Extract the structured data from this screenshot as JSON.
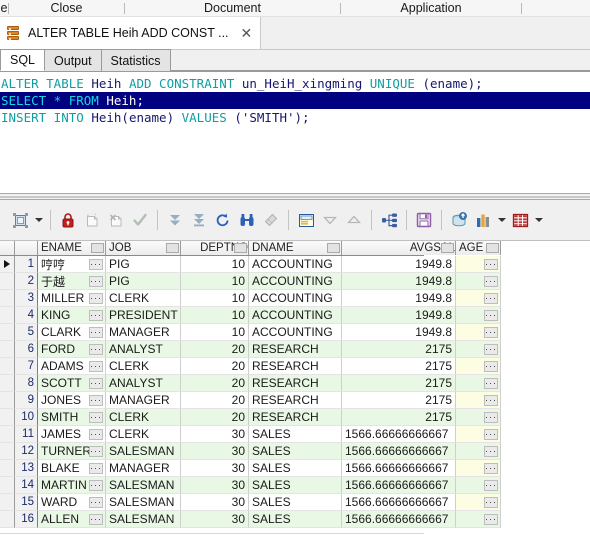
{
  "menubar": {
    "partial": "e",
    "items": [
      "Close",
      "Document",
      "Application"
    ]
  },
  "doc_tab": {
    "icon": "database-icon",
    "title": "ALTER TABLE Heih ADD CONST ...",
    "close_label": "✕"
  },
  "subtabs": [
    {
      "label": "SQL",
      "active": true
    },
    {
      "label": "Output",
      "active": false
    },
    {
      "label": "Statistics",
      "active": false
    }
  ],
  "editor": {
    "lines": [
      {
        "selected": false,
        "parts": [
          {
            "t": "ALTER TABLE ",
            "c": "kw"
          },
          {
            "t": "Heih ",
            "c": "id"
          },
          {
            "t": "ADD CONSTRAINT ",
            "c": "kw"
          },
          {
            "t": "un_HeiH_xingming ",
            "c": "id"
          },
          {
            "t": "UNIQUE ",
            "c": "kw"
          },
          {
            "t": "(ename);",
            "c": "id"
          }
        ]
      },
      {
        "selected": true,
        "parts": [
          {
            "t": "SELECT * FROM ",
            "c": "kw"
          },
          {
            "t": "Heih;",
            "c": "id"
          }
        ]
      },
      {
        "selected": false,
        "parts": [
          {
            "t": "INSERT INTO ",
            "c": "kw"
          },
          {
            "t": "Heih(ename) ",
            "c": "id"
          },
          {
            "t": "VALUES ",
            "c": "kw"
          },
          {
            "t": "('SMITH');",
            "c": "id"
          }
        ]
      }
    ]
  },
  "result_toolbar": {
    "buttons": [
      {
        "name": "single-record-view-icon",
        "kind": "record"
      },
      {
        "name": "dropdown-caret-icon",
        "kind": "caret"
      },
      {
        "name": "separator",
        "kind": "sep"
      },
      {
        "name": "lock-icon",
        "kind": "lock"
      },
      {
        "name": "insert-record-icon",
        "kind": "insert"
      },
      {
        "name": "delete-record-icon",
        "kind": "delete"
      },
      {
        "name": "post-changes-icon",
        "kind": "check"
      },
      {
        "name": "separator",
        "kind": "sep"
      },
      {
        "name": "fetch-next-page-icon",
        "kind": "dblarrow"
      },
      {
        "name": "fetch-all-rows-icon",
        "kind": "arrowbar"
      },
      {
        "name": "refresh-icon",
        "kind": "refresh"
      },
      {
        "name": "find-icon",
        "kind": "binoculars"
      },
      {
        "name": "clear-filter-icon",
        "kind": "eraser"
      },
      {
        "name": "separator",
        "kind": "sep"
      },
      {
        "name": "form-view-icon",
        "kind": "form"
      },
      {
        "name": "sort-descending-icon",
        "kind": "triangle-down"
      },
      {
        "name": "sort-ascending-icon",
        "kind": "triangle-up"
      },
      {
        "name": "separator",
        "kind": "sep"
      },
      {
        "name": "data-lineage-icon",
        "kind": "lineage"
      },
      {
        "name": "separator",
        "kind": "sep"
      },
      {
        "name": "save-icon",
        "kind": "save"
      },
      {
        "name": "separator",
        "kind": "sep"
      },
      {
        "name": "export-database-icon",
        "kind": "dbexport"
      },
      {
        "name": "chart-icon",
        "kind": "chart"
      },
      {
        "name": "dropdown-caret-icon",
        "kind": "caret"
      },
      {
        "name": "grid-export-icon",
        "kind": "gridexport"
      },
      {
        "name": "dropdown-caret-icon",
        "kind": "caret"
      }
    ]
  },
  "grid": {
    "columns": [
      "ENAME",
      "JOB",
      "DEPTNO",
      "DNAME",
      "AVGSAL",
      "AGE"
    ],
    "rows": [
      {
        "n": "1",
        "ename": "哼哼",
        "job": "PIG",
        "deptno": "10",
        "dname": "ACCOUNTING",
        "avgsal": "1949.8",
        "age": ""
      },
      {
        "n": "2",
        "ename": "于越",
        "job": "PIG",
        "deptno": "10",
        "dname": "ACCOUNTING",
        "avgsal": "1949.8",
        "age": ""
      },
      {
        "n": "3",
        "ename": "MILLER",
        "job": "CLERK",
        "deptno": "10",
        "dname": "ACCOUNTING",
        "avgsal": "1949.8",
        "age": ""
      },
      {
        "n": "4",
        "ename": "KING",
        "job": "PRESIDENT",
        "deptno": "10",
        "dname": "ACCOUNTING",
        "avgsal": "1949.8",
        "age": ""
      },
      {
        "n": "5",
        "ename": "CLARK",
        "job": "MANAGER",
        "deptno": "10",
        "dname": "ACCOUNTING",
        "avgsal": "1949.8",
        "age": ""
      },
      {
        "n": "6",
        "ename": "FORD",
        "job": "ANALYST",
        "deptno": "20",
        "dname": "RESEARCH",
        "avgsal": "2175",
        "age": ""
      },
      {
        "n": "7",
        "ename": "ADAMS",
        "job": "CLERK",
        "deptno": "20",
        "dname": "RESEARCH",
        "avgsal": "2175",
        "age": ""
      },
      {
        "n": "8",
        "ename": "SCOTT",
        "job": "ANALYST",
        "deptno": "20",
        "dname": "RESEARCH",
        "avgsal": "2175",
        "age": ""
      },
      {
        "n": "9",
        "ename": "JONES",
        "job": "MANAGER",
        "deptno": "20",
        "dname": "RESEARCH",
        "avgsal": "2175",
        "age": ""
      },
      {
        "n": "10",
        "ename": "SMITH",
        "job": "CLERK",
        "deptno": "20",
        "dname": "RESEARCH",
        "avgsal": "2175",
        "age": ""
      },
      {
        "n": "11",
        "ename": "JAMES",
        "job": "CLERK",
        "deptno": "30",
        "dname": "SALES",
        "avgsal": "1566.66666666667",
        "age": ""
      },
      {
        "n": "12",
        "ename": "TURNER",
        "job": "SALESMAN",
        "deptno": "30",
        "dname": "SALES",
        "avgsal": "1566.66666666667",
        "age": ""
      },
      {
        "n": "13",
        "ename": "BLAKE",
        "job": "MANAGER",
        "deptno": "30",
        "dname": "SALES",
        "avgsal": "1566.66666666667",
        "age": ""
      },
      {
        "n": "14",
        "ename": "MARTIN",
        "job": "SALESMAN",
        "deptno": "30",
        "dname": "SALES",
        "avgsal": "1566.66666666667",
        "age": ""
      },
      {
        "n": "15",
        "ename": "WARD",
        "job": "SALESMAN",
        "deptno": "30",
        "dname": "SALES",
        "avgsal": "1566.66666666667",
        "age": ""
      },
      {
        "n": "16",
        "ename": "ALLEN",
        "job": "SALESMAN",
        "deptno": "30",
        "dname": "SALES",
        "avgsal": "1566.66666666667",
        "age": ""
      }
    ],
    "cell_ellipsis": "···",
    "current_row": 1
  },
  "colors": {
    "keyword": "#0f9ea3",
    "identifier": "#161670",
    "selection": "#000080",
    "row_alt": "#e9f7e5",
    "null_cell": "#fdfde4",
    "tab_icon": "#e08428"
  }
}
